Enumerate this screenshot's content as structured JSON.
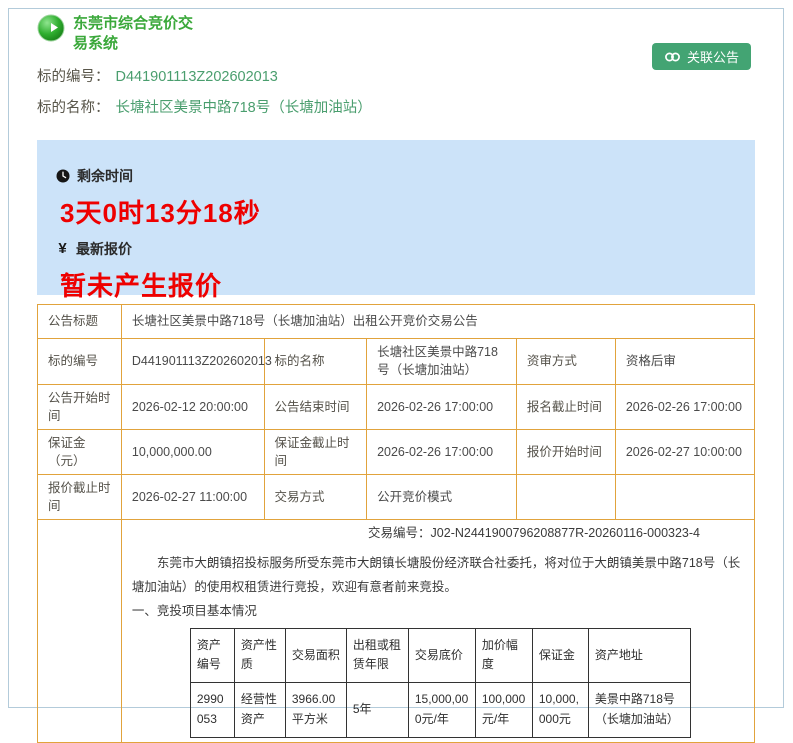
{
  "header": {
    "system_title": "东莞市综合竞价交易系统",
    "link_button_label": "关联公告",
    "subject_number_label": "标的编号：",
    "subject_number_value": "D441901113Z202602013",
    "subject_name_label": "标的名称：",
    "subject_name_value": "长塘社区美景中路718号（长塘加油站）"
  },
  "status_panel": {
    "remaining_time_label": "剩余时间",
    "remaining_time_value": "3天0时13分18秒",
    "latest_offer_icon": "¥",
    "latest_offer_label": "最新报价",
    "latest_offer_value": "暂未产生报价"
  },
  "info_table": {
    "title_label": "公告标题",
    "title_value": "长塘社区美景中路718号（长塘加油站）出租公开竞价交易公告",
    "rows": [
      [
        {
          "label": "标的编号",
          "value": "D441901113Z202602013"
        },
        {
          "label": "标的名称",
          "value": "长塘社区美景中路718号（长塘加油站）"
        },
        {
          "label": "资审方式",
          "value": "资格后审"
        }
      ],
      [
        {
          "label": "公告开始时间",
          "value": "2026-02-12 20:00:00"
        },
        {
          "label": "公告结束时间",
          "value": "2026-02-26 17:00:00"
        },
        {
          "label": "报名截止时间",
          "value": "2026-02-26 17:00:00"
        }
      ],
      [
        {
          "label": "保证金（元）",
          "value": "10,000,000.00"
        },
        {
          "label": "保证金截止时间",
          "value": "2026-02-26 17:00:00"
        },
        {
          "label": "报价开始时间",
          "value": "2026-02-27 10:00:00"
        }
      ],
      [
        {
          "label": "报价截止时间",
          "value": "2026-02-27 11:00:00"
        },
        {
          "label": "交易方式",
          "value": "公开竞价模式"
        },
        {
          "label": "",
          "value": ""
        }
      ]
    ]
  },
  "announcement": {
    "transaction_number_label": "交易编号：",
    "transaction_number_value": "J02-N2441900796208877R-20260116-000323-4",
    "paragraph": "东莞市大朗镇招投标服务所受东莞市大朗镇长塘股份经济联合社委托，将对位于大朗镇美景中路718号（长塘加油站）的使用权租赁进行竞投，欢迎有意者前来竞投。",
    "section_heading": "一、竞投项目基本情况",
    "project_table": {
      "headers": [
        "资产编号",
        "资产性质",
        "交易面积",
        "出租或租赁年限",
        "交易底价",
        "加价幅度",
        "保证金",
        "资产地址"
      ],
      "rows": [
        [
          "2990053",
          "经营性资产",
          "3966.00平方米",
          "5年",
          "15,000,000元/年",
          "100,000元/年",
          "10,000,000元",
          "美景中路718号（长塘加油站）"
        ]
      ]
    }
  },
  "colors": {
    "accent_green": "#3aa83a",
    "value_green": "#4a9e6e",
    "button_green": "#43a473",
    "alert_red": "#ee0000",
    "table_border_gold": "#e1a33c",
    "panel_blue": "#cce3f9"
  }
}
